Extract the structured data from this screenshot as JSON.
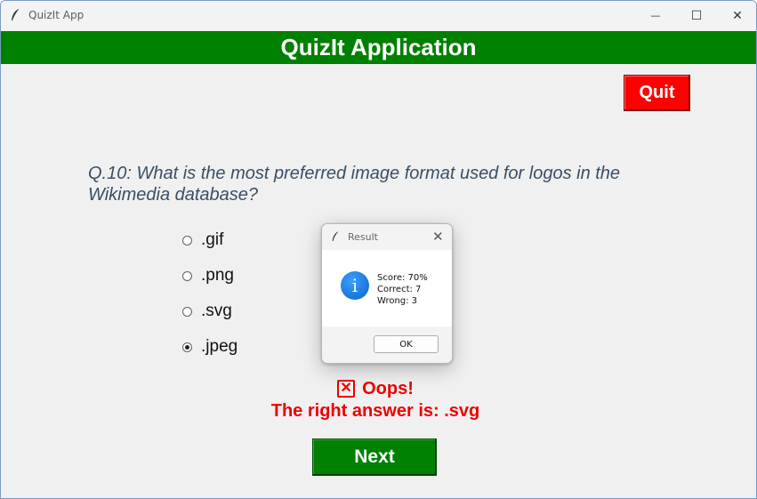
{
  "window": {
    "title": "QuizIt App",
    "minimize_glyph": "—",
    "maximize_glyph": "☐",
    "close_glyph": "✕"
  },
  "header": {
    "title": "QuizIt Application",
    "color": "#008000"
  },
  "quit_label": "Quit",
  "question": "Q.10: What is the most preferred image format used for logos in the Wikimedia database?",
  "options": [
    {
      "label": ".gif",
      "selected": false
    },
    {
      "label": ".png",
      "selected": false
    },
    {
      "label": ".svg",
      "selected": false
    },
    {
      "label": ".jpeg",
      "selected": true
    }
  ],
  "feedback": {
    "icon": "x-box-icon",
    "oops": "Oops!",
    "answer": "The right answer is: .svg",
    "color": "#ee0000"
  },
  "next_label": "Next",
  "dialog": {
    "title": "Result",
    "icon": "info-icon",
    "lines": [
      "Score: 70%",
      "Correct: 7",
      "Wrong: 3"
    ],
    "ok_label": "OK"
  }
}
